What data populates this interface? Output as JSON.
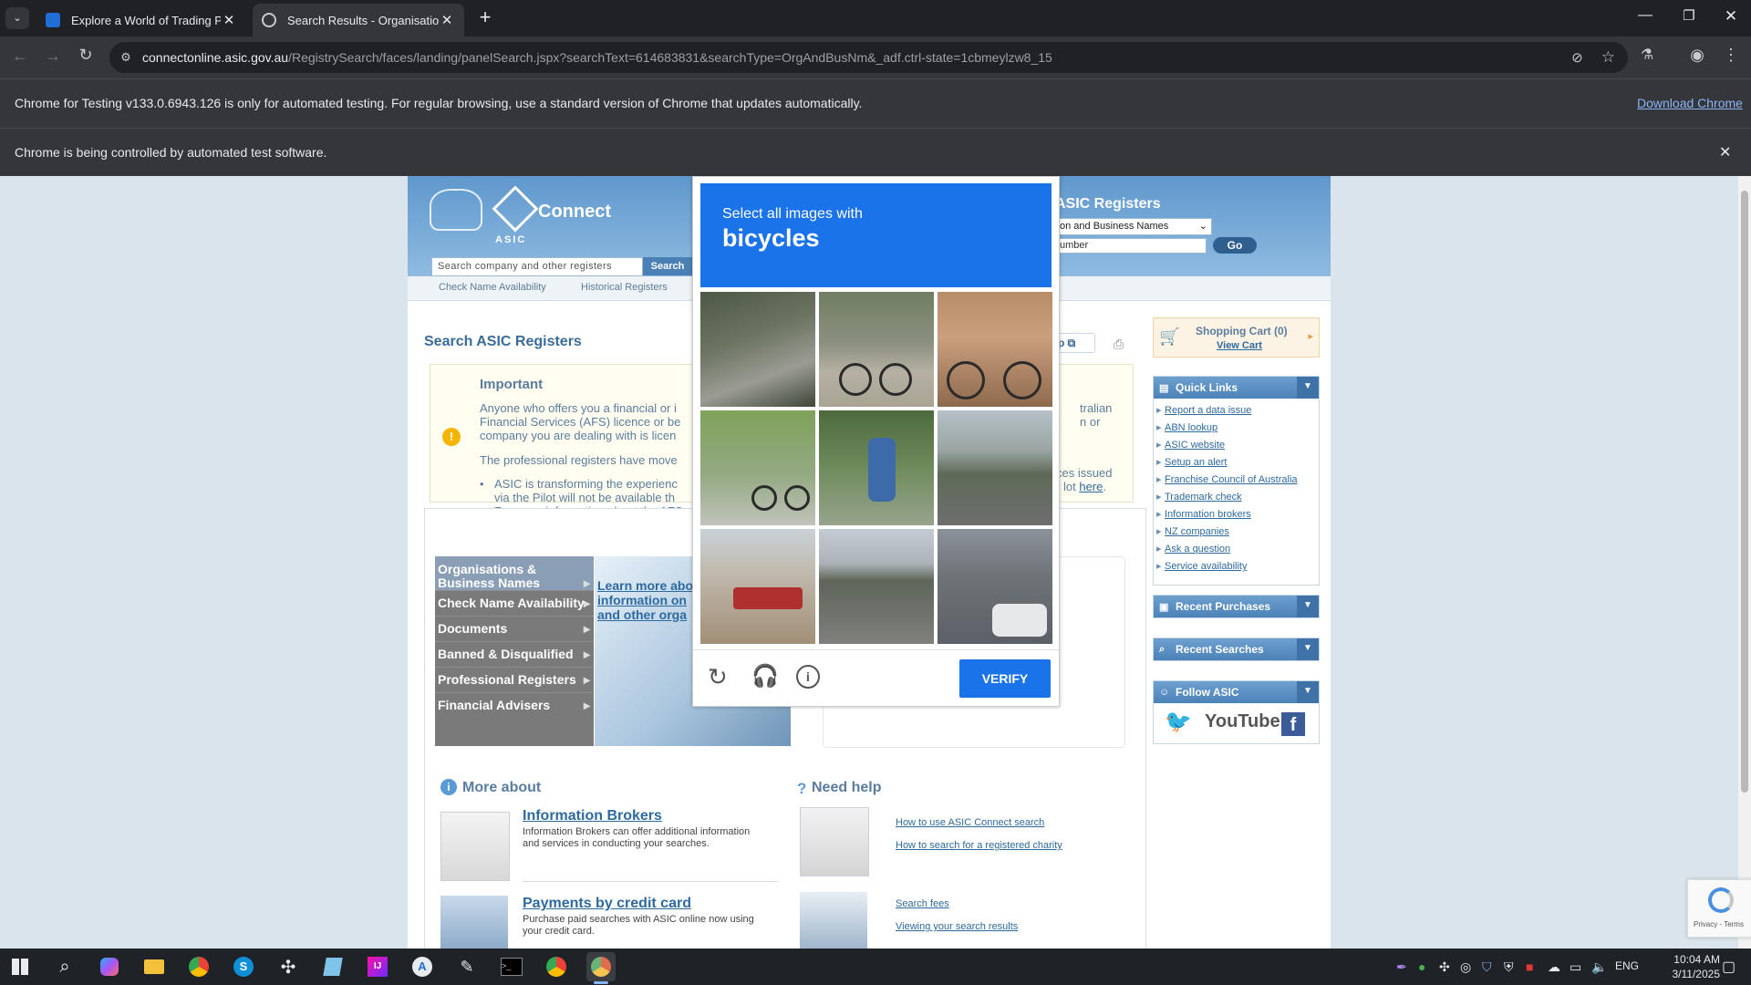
{
  "browser": {
    "tabs": [
      {
        "title": "Explore a World of Trading Pos",
        "active": false
      },
      {
        "title": "Search Results - Organisations &",
        "active": true
      }
    ],
    "url_host": "connectonline.asic.gov.au",
    "url_path": "/RegistrySearch/faces/landing/panelSearch.jspx?searchText=614683831&searchType=OrgAndBusNm&_adf.ctrl-state=1cbmeylzw8_15",
    "infobar_testing": "Chrome for Testing v133.0.6943.126 is only for automated testing. For regular browsing, use a standard version of Chrome that updates automatically.",
    "download_link": "Download Chrome",
    "infobar_automation": "Chrome is being controlled by automated test software."
  },
  "site": {
    "brand": "Connect",
    "asic_label": "ASIC",
    "search_placeholder": "Search company and other registers",
    "search_button": "Search",
    "registers_title": "ASIC Registers",
    "register_select": "on and Business Names",
    "number_field": "umber",
    "go_button": "Go",
    "subnav": [
      "Check Name Availability",
      "Historical Registers"
    ],
    "page_title": "Search ASIC Registers",
    "help_label": "elp",
    "important": {
      "title": "Important",
      "left_lines": [
        "Anyone who offers you a financial or i",
        "Financial Services (AFS) licence or be",
        "company you are dealing with is licen"
      ],
      "right_lines": [
        "tralian",
        "n or"
      ],
      "p2": "The professional registers have move",
      "bullet_left": [
        "ASIC is transforming the experienc",
        "via the Pilot will not be available th",
        "For more information about the AFS"
      ],
      "bullet_right_1": "ces issued",
      "bullet_right_2_pre": "lot ",
      "bullet_right_2_link": "here",
      "bullet_right_2_post": "."
    },
    "menu": [
      "Organisations & Business Names",
      "Check Name Availability",
      "Documents",
      "Banned & Disqualified",
      "Professional Registers",
      "Financial Advisers"
    ],
    "learn_more_lines": [
      "Learn more abo",
      "information on",
      "and other orga"
    ],
    "more_about": "More about",
    "need_help": "Need help",
    "info_brokers_title": "Information Brokers",
    "info_brokers_text": "Information Brokers can offer additional information and services in conducting your searches.",
    "payments_title": "Payments by credit card",
    "payments_text": "Purchase paid searches with ASIC online now using your credit card.",
    "help_links": [
      "How to use ASIC Connect search",
      "How to search for a registered charity"
    ],
    "help_links2": [
      "Search fees",
      "Viewing your search results"
    ],
    "cart": {
      "title": "Shopping Cart (0)",
      "view": "View Cart"
    },
    "quick_links_title": "Quick Links",
    "quick_links": [
      "Report a data issue",
      "ABN lookup",
      "ASIC website",
      "Setup an alert",
      "Franchise Council of Australia",
      "Trademark check",
      "Information brokers",
      "NZ companies",
      "Ask a question",
      "Service availability"
    ],
    "recent_purchases": "Recent Purchases",
    "recent_searches": "Recent Searches",
    "follow": "Follow ASIC",
    "youtube": "YouTube",
    "recaptcha_footer": "Privacy - Terms"
  },
  "captcha": {
    "instruction": "Select all images with",
    "target": "bicycles",
    "verify": "VERIFY",
    "tiles": [
      "stairs-by-trees",
      "boy-on-bicycle",
      "man-riding-bicycle",
      "person-cycling-on-grass",
      "person-walking-bicycle",
      "highway-road",
      "street-corner-truck",
      "highway-overpass",
      "city-street-traffic"
    ]
  },
  "taskbar": {
    "lang": "ENG",
    "time": "10:04 AM",
    "date": "3/11/2025"
  }
}
